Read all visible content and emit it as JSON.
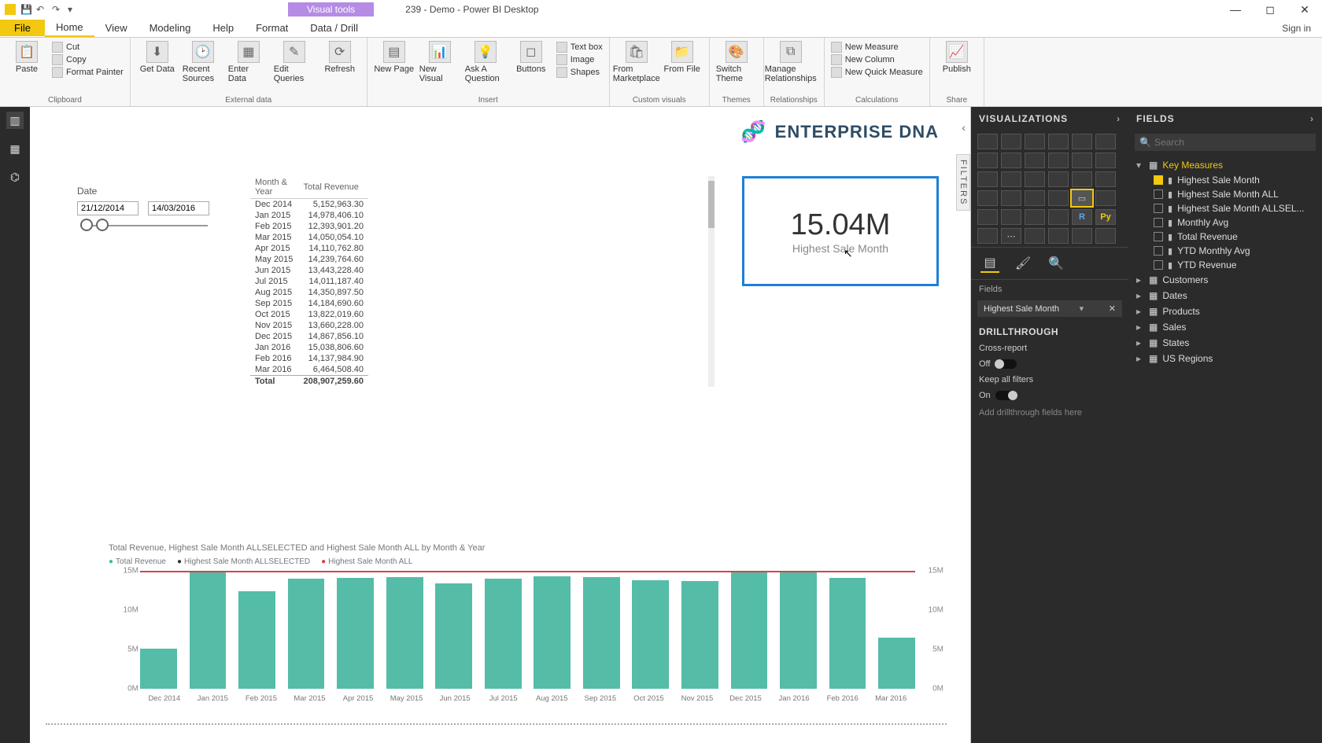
{
  "window": {
    "context_tab": "Visual tools",
    "title": "239 - Demo - Power BI Desktop",
    "signin": "Sign in"
  },
  "menu": {
    "file": "File",
    "tabs": [
      "Home",
      "View",
      "Modeling",
      "Help",
      "Format",
      "Data / Drill"
    ]
  },
  "ribbon": {
    "clipboard": {
      "paste": "Paste",
      "cut": "Cut",
      "copy": "Copy",
      "painter": "Format Painter",
      "label": "Clipboard"
    },
    "external": {
      "get": "Get Data",
      "recent": "Recent Sources",
      "enter": "Enter Data",
      "edit": "Edit Queries",
      "refresh": "Refresh",
      "label": "External data"
    },
    "insert": {
      "page": "New Page",
      "visual": "New Visual",
      "ask": "Ask A Question",
      "buttons": "Buttons",
      "textbox": "Text box",
      "image": "Image",
      "shapes": "Shapes",
      "label": "Insert"
    },
    "custom": {
      "market": "From Marketplace",
      "file": "From File",
      "label": "Custom visuals"
    },
    "themes": {
      "switch": "Switch Theme",
      "label": "Themes"
    },
    "rel": {
      "manage": "Manage Relationships",
      "label": "Relationships"
    },
    "calc": {
      "measure": "New Measure",
      "column": "New Column",
      "quick": "New Quick Measure",
      "label": "Calculations"
    },
    "share": {
      "publish": "Publish",
      "label": "Share"
    }
  },
  "canvas": {
    "brand": "ENTERPRISE DNA",
    "filters_tab": "FILTERS",
    "slicer": {
      "title": "Date",
      "from": "21/12/2014",
      "to": "14/03/2016"
    },
    "table": {
      "cols": [
        "Month & Year",
        "Total Revenue"
      ],
      "rows": [
        [
          "Dec 2014",
          "5,152,963.30"
        ],
        [
          "Jan 2015",
          "14,978,406.10"
        ],
        [
          "Feb 2015",
          "12,393,901.20"
        ],
        [
          "Mar 2015",
          "14,050,054.10"
        ],
        [
          "Apr 2015",
          "14,110,762.80"
        ],
        [
          "May 2015",
          "14,239,764.60"
        ],
        [
          "Jun 2015",
          "13,443,228.40"
        ],
        [
          "Jul 2015",
          "14,011,187.40"
        ],
        [
          "Aug 2015",
          "14,350,897.50"
        ],
        [
          "Sep 2015",
          "14,184,690.60"
        ],
        [
          "Oct 2015",
          "13,822,019.60"
        ],
        [
          "Nov 2015",
          "13,660,228.00"
        ],
        [
          "Dec 2015",
          "14,867,856.10"
        ],
        [
          "Jan 2016",
          "15,038,806.60"
        ],
        [
          "Feb 2016",
          "14,137,984.90"
        ],
        [
          "Mar 2016",
          "6,464,508.40"
        ]
      ],
      "total_label": "Total",
      "total_value": "208,907,259.60"
    },
    "card": {
      "value": "15.04M",
      "label": "Highest Sale Month"
    },
    "chart": {
      "title": "Total Revenue, Highest Sale Month ALLSELECTED and Highest Sale Month ALL by Month & Year",
      "legend": [
        "Total Revenue",
        "Highest Sale Month ALLSELECTED",
        "Highest Sale Month ALL"
      ]
    }
  },
  "chart_data": {
    "type": "bar",
    "categories": [
      "Dec 2014",
      "Jan 2015",
      "Feb 2015",
      "Mar 2015",
      "Apr 2015",
      "May 2015",
      "Jun 2015",
      "Jul 2015",
      "Aug 2015",
      "Sep 2015",
      "Oct 2015",
      "Nov 2015",
      "Dec 2015",
      "Jan 2016",
      "Feb 2016",
      "Mar 2016"
    ],
    "series": [
      {
        "name": "Total Revenue",
        "values": [
          5.15,
          14.98,
          12.39,
          14.05,
          14.11,
          14.24,
          13.44,
          14.01,
          14.35,
          14.18,
          13.82,
          13.66,
          14.87,
          15.04,
          14.14,
          6.46
        ]
      },
      {
        "name": "Highest Sale Month ALLSELECTED",
        "values": [
          15.04,
          15.04,
          15.04,
          15.04,
          15.04,
          15.04,
          15.04,
          15.04,
          15.04,
          15.04,
          15.04,
          15.04,
          15.04,
          15.04,
          15.04,
          15.04
        ]
      },
      {
        "name": "Highest Sale Month ALL",
        "values": [
          15.04,
          15.04,
          15.04,
          15.04,
          15.04,
          15.04,
          15.04,
          15.04,
          15.04,
          15.04,
          15.04,
          15.04,
          15.04,
          15.04,
          15.04,
          15.04
        ]
      }
    ],
    "ylabel": "",
    "xlabel": "",
    "ylim": [
      0,
      15
    ],
    "yticks": [
      "0M",
      "5M",
      "10M",
      "15M"
    ]
  },
  "vis": {
    "header": "VISUALIZATIONS",
    "fields_label": "Fields",
    "pill": "Highest Sale Month",
    "drill_header": "DRILLTHROUGH",
    "cross": "Cross-report",
    "cross_state": "Off",
    "keep": "Keep all filters",
    "keep_state": "On",
    "drop": "Add drillthrough fields here"
  },
  "fields": {
    "header": "FIELDS",
    "search_ph": "Search",
    "tables": [
      {
        "name": "Key Measures",
        "expanded": true,
        "fields": [
          {
            "name": "Highest Sale Month",
            "checked": true
          },
          {
            "name": "Highest Sale Month ALL",
            "checked": false
          },
          {
            "name": "Highest Sale Month ALLSEL...",
            "checked": false
          },
          {
            "name": "Monthly Avg",
            "checked": false
          },
          {
            "name": "Total Revenue",
            "checked": false
          },
          {
            "name": "YTD Monthly Avg",
            "checked": false
          },
          {
            "name": "YTD Revenue",
            "checked": false
          }
        ]
      },
      {
        "name": "Customers",
        "expanded": false
      },
      {
        "name": "Dates",
        "expanded": false
      },
      {
        "name": "Products",
        "expanded": false
      },
      {
        "name": "Sales",
        "expanded": false
      },
      {
        "name": "States",
        "expanded": false
      },
      {
        "name": "US Regions",
        "expanded": false
      }
    ]
  }
}
